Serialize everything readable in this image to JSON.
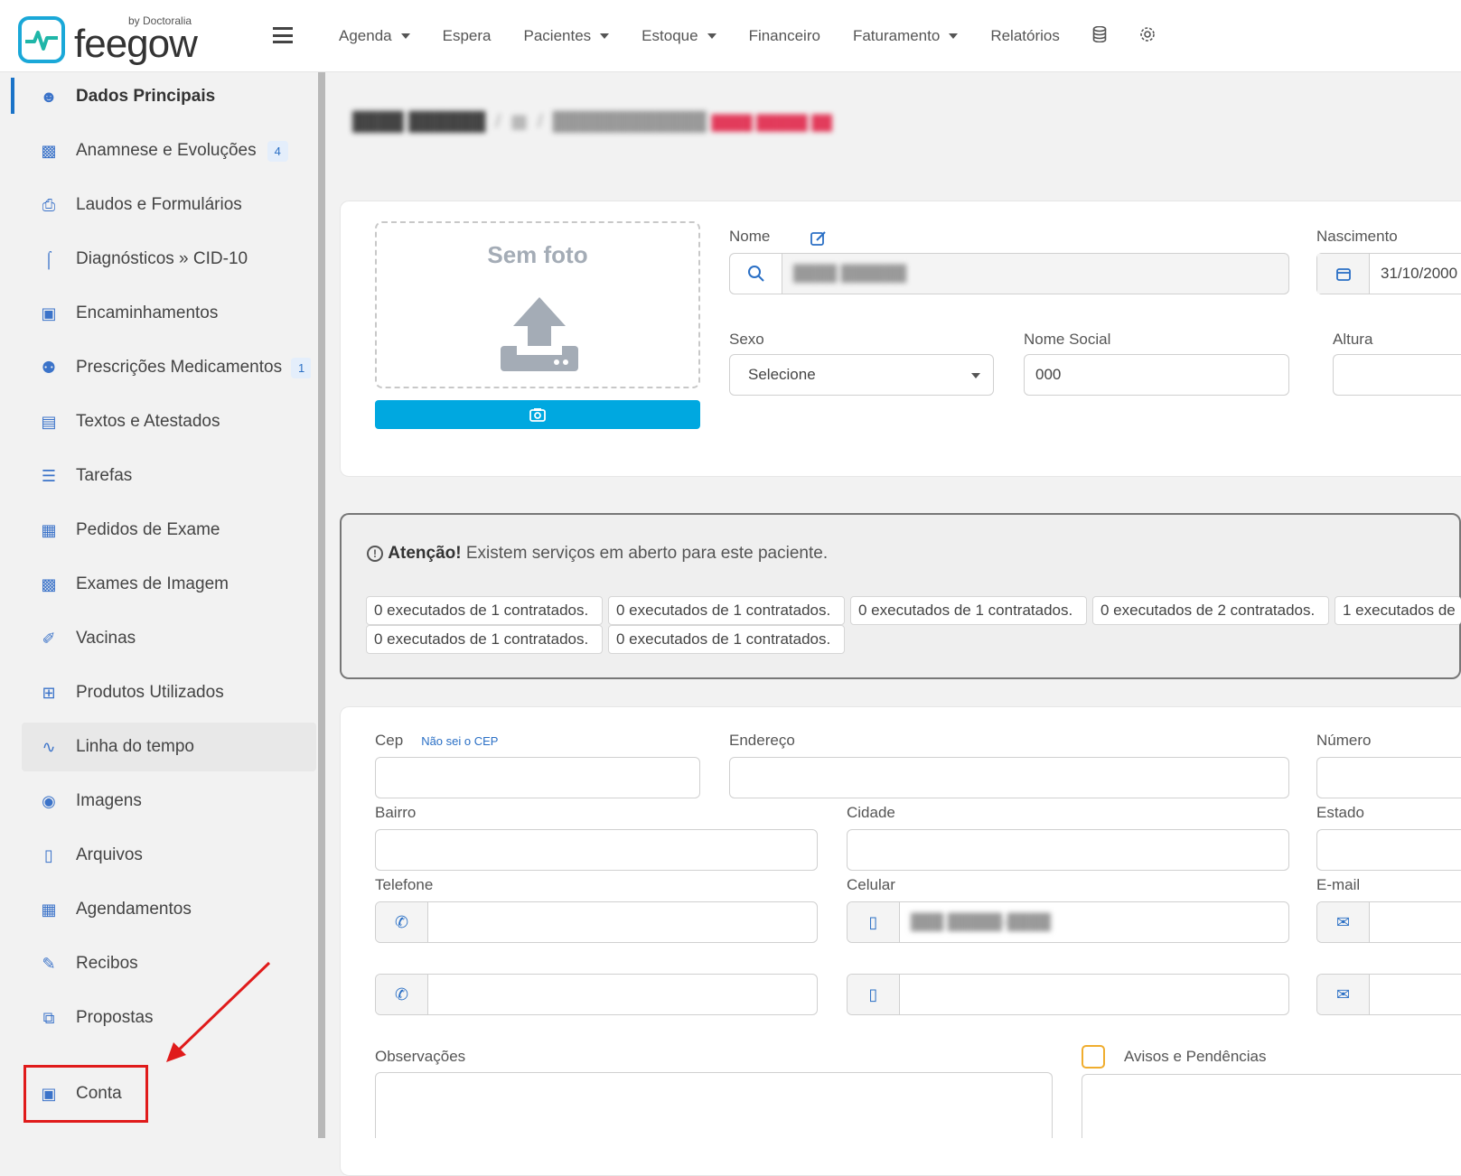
{
  "brand": {
    "name": "feegow",
    "by": "by Doctoralia"
  },
  "nav": {
    "items": [
      {
        "label": "Agenda",
        "dropdown": true
      },
      {
        "label": "Espera",
        "dropdown": false
      },
      {
        "label": "Pacientes",
        "dropdown": true
      },
      {
        "label": "Estoque",
        "dropdown": true
      },
      {
        "label": "Financeiro",
        "dropdown": false
      },
      {
        "label": "Faturamento",
        "dropdown": true
      },
      {
        "label": "Relatórios",
        "dropdown": false
      }
    ],
    "icons": [
      "database-icon",
      "gear-icon"
    ]
  },
  "sidebar": {
    "items": [
      {
        "label": "Dados Principais",
        "icon": "user-icon",
        "active": true
      },
      {
        "label": "Anamnese e Evoluções",
        "icon": "chart-icon",
        "badge": "4"
      },
      {
        "label": "Laudos e Formulários",
        "icon": "clipboard-icon"
      },
      {
        "label": "Diagnósticos » CID-10",
        "icon": "stethoscope-icon"
      },
      {
        "label": "Encaminhamentos",
        "icon": "document-icon"
      },
      {
        "label": "Prescrições Medicamentos",
        "icon": "pills-icon",
        "badge": "1"
      },
      {
        "label": "Textos e Atestados",
        "icon": "file-text-icon"
      },
      {
        "label": "Tarefas",
        "icon": "list-icon"
      },
      {
        "label": "Pedidos de Exame",
        "icon": "hospital-icon"
      },
      {
        "label": "Exames de Imagem",
        "icon": "image-exam-icon"
      },
      {
        "label": "Vacinas",
        "icon": "syringe-icon"
      },
      {
        "label": "Produtos Utilizados",
        "icon": "medkit-icon"
      },
      {
        "label": "Linha do tempo",
        "icon": "timeline-icon",
        "highlight": true
      },
      {
        "label": "Imagens",
        "icon": "camera-icon"
      },
      {
        "label": "Arquivos",
        "icon": "file-icon"
      },
      {
        "label": "Agendamentos",
        "icon": "calendar-icon"
      },
      {
        "label": "Recibos",
        "icon": "edit-icon"
      },
      {
        "label": "Propostas",
        "icon": "copy-icon"
      },
      {
        "label": "Conta",
        "icon": "money-icon"
      }
    ]
  },
  "photo": {
    "title": "Sem foto"
  },
  "form": {
    "nome_label": "Nome",
    "nascimento_label": "Nascimento",
    "nascimento_value": "31/10/2000",
    "sexo_label": "Sexo",
    "sexo_value": "Selecione",
    "nome_social_label": "Nome Social",
    "nome_social_value": "000",
    "altura_label": "Altura"
  },
  "alert": {
    "title": "Atenção!",
    "message": "Existem serviços em aberto para este paciente.",
    "chips": [
      "0 executados de 1 contratados.",
      "0 executados de 1 contratados.",
      "0 executados de 1 contratados.",
      "0 executados de 2 contratados.",
      "1 executados de",
      "0 executados de 1 contratados.",
      "0 executados de 1 contratados."
    ]
  },
  "address": {
    "cep_label": "Cep",
    "cep_link": "Não sei o CEP",
    "endereco_label": "Endereço",
    "numero_label": "Número",
    "bairro_label": "Bairro",
    "cidade_label": "Cidade",
    "estado_label": "Estado",
    "telefone_label": "Telefone",
    "celular_label": "Celular",
    "email_label": "E-mail",
    "observacoes_label": "Observações",
    "avisos_label": "Avisos e Pendências"
  },
  "colors": {
    "accent": "#1a73c8",
    "camera_button": "#00a8e0",
    "annotation": "#e01b1b"
  }
}
